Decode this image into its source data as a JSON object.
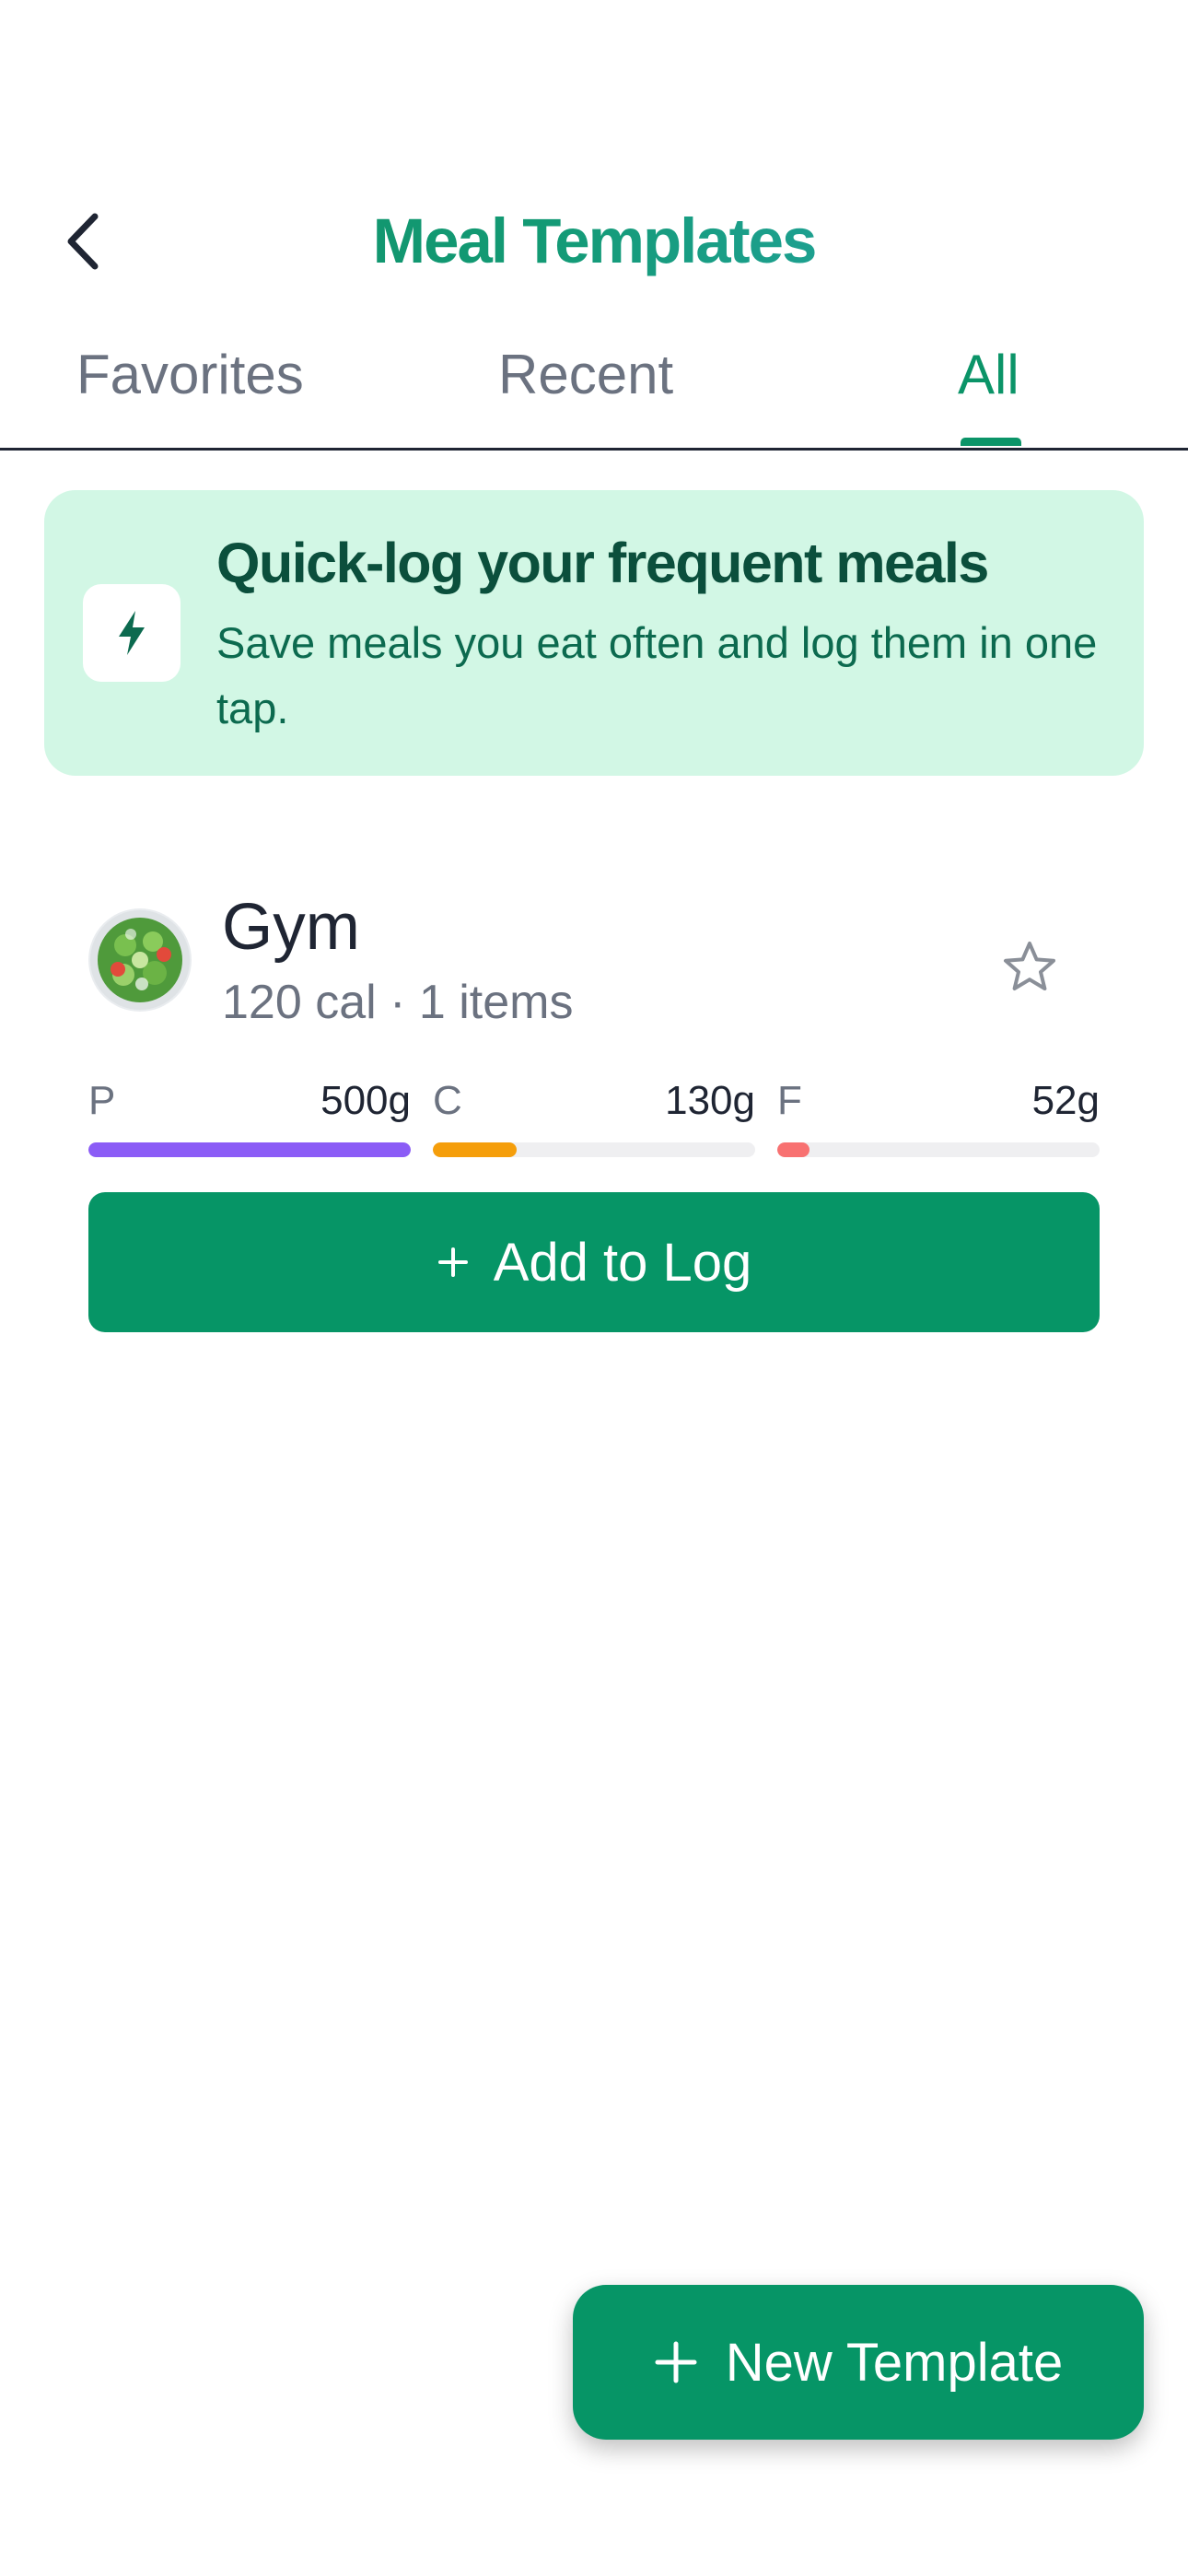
{
  "header": {
    "title": "Meal Templates"
  },
  "tabs": [
    {
      "label": "Favorites",
      "active": false
    },
    {
      "label": "Recent",
      "active": false
    },
    {
      "label": "All",
      "active": true
    }
  ],
  "banner": {
    "title": "Quick-log your frequent meals",
    "text": "Save meals you eat often and log them in one tap.",
    "icon": "lightning-icon"
  },
  "templates": [
    {
      "name": "Gym",
      "meta": "120 cal · 1 items",
      "favorite": false,
      "macros": [
        {
          "letter": "P",
          "amount": "500g",
          "fill": 1.0,
          "color": "#8b5cf6"
        },
        {
          "letter": "C",
          "amount": "130g",
          "fill": 0.26,
          "color": "#f59e0b"
        },
        {
          "letter": "F",
          "amount": "52g",
          "fill": 0.1,
          "color": "#f87171"
        }
      ],
      "add_label": "Add to Log"
    }
  ],
  "fab": {
    "label": "New Template"
  },
  "colors": {
    "accent": "#069566",
    "banner_bg": "#d2f7e5",
    "title_gradient_start": "#0f8f66",
    "title_gradient_end": "#2aa7b3"
  }
}
